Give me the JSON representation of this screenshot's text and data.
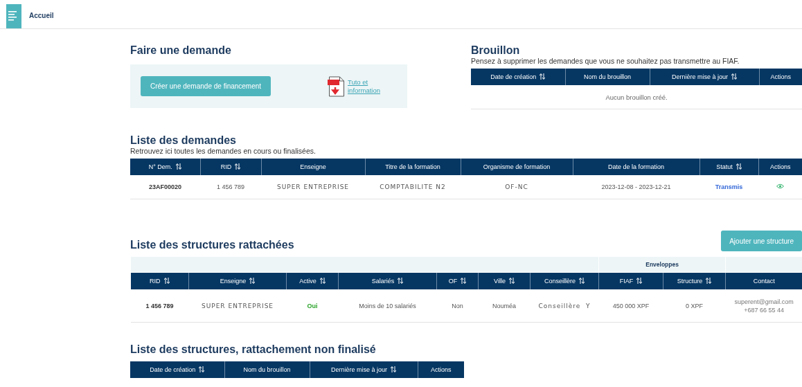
{
  "header": {
    "title": "Accueil"
  },
  "new_request": {
    "title": "Faire une demande",
    "button": "Créer une demande de financement",
    "link": "Tuto et information"
  },
  "drafts": {
    "title": "Brouillon",
    "subtitle": "Pensez à supprimer les demandes que vous ne souhaitez pas transmettre au FIAF.",
    "columns": [
      {
        "label": "Date de création",
        "sortable": true
      },
      {
        "label": "Nom du brouillon",
        "sortable": false
      },
      {
        "label": "Dernière mise à jour",
        "sortable": true
      },
      {
        "label": "Actions",
        "sortable": false
      }
    ],
    "empty": "Aucun brouillon créé."
  },
  "requests": {
    "title": "Liste des demandes",
    "subtitle": "Retrouvez ici toutes les demandes en cours ou finalisées.",
    "columns": [
      {
        "label": "N° Dem.",
        "sortable": true
      },
      {
        "label": "RID",
        "sortable": true
      },
      {
        "label": "Enseigne",
        "sortable": false
      },
      {
        "label": "Titre de la formation",
        "sortable": false
      },
      {
        "label": "Organisme de formation",
        "sortable": false
      },
      {
        "label": "Date de la formation",
        "sortable": false
      },
      {
        "label": "Statut",
        "sortable": true
      },
      {
        "label": "Actions",
        "sortable": false
      }
    ],
    "rows": [
      [
        {
          "kind": "bold",
          "text": "23AF00020"
        },
        {
          "kind": "plain",
          "text": "1 456 789"
        },
        {
          "kind": "spaced",
          "text": "SUPER ENTREPRISE"
        },
        {
          "kind": "spaced",
          "text": "COMPTABILITE N2"
        },
        {
          "kind": "spaced",
          "text": "OF-NC"
        },
        {
          "kind": "plain",
          "text": "2023-12-08 - 2023-12-21"
        },
        {
          "kind": "status",
          "text": "Transmis"
        },
        {
          "kind": "view"
        }
      ]
    ]
  },
  "structures": {
    "title": "Liste des structures rattachées",
    "button": "Ajouter une structure",
    "group": "Enveloppes",
    "columns": [
      {
        "label": "RID",
        "sortable": true
      },
      {
        "label": "Enseigne",
        "sortable": true
      },
      {
        "label": "Active",
        "sortable": true
      },
      {
        "label": "Salariés",
        "sortable": true
      },
      {
        "label": "OF",
        "sortable": true
      },
      {
        "label": "Ville",
        "sortable": true
      },
      {
        "label": "Conseillère",
        "sortable": true
      },
      {
        "label": "FIAF",
        "sortable": true
      },
      {
        "label": "Structure",
        "sortable": true
      },
      {
        "label": "Contact",
        "sortable": false
      }
    ],
    "rows": [
      [
        {
          "kind": "bold",
          "text": "1 456 789"
        },
        {
          "kind": "spaced",
          "text": "SUPER ENTREPRISE"
        },
        {
          "kind": "active",
          "text": "Oui"
        },
        {
          "kind": "plain",
          "text": "Moins de 10 salariés"
        },
        {
          "kind": "plain",
          "text": "Non"
        },
        {
          "kind": "plain",
          "text": "Nouméa"
        },
        {
          "kind": "spaced",
          "text": "Conseillère  Y"
        },
        {
          "kind": "plain",
          "text": "450 000 XPF"
        },
        {
          "kind": "plain",
          "text": "0 XPF"
        },
        {
          "kind": "contact",
          "lines": [
            "superent@gmail.com",
            "+687 66 55 44"
          ]
        }
      ]
    ]
  },
  "pending": {
    "title": "Liste des structures, rattachement non finalisé",
    "columns": [
      {
        "label": "Date de création",
        "sortable": true
      },
      {
        "label": "Nom du brouillon",
        "sortable": false
      },
      {
        "label": "Dernière mise à jour",
        "sortable": true
      },
      {
        "label": "Actions",
        "sortable": false
      }
    ]
  }
}
